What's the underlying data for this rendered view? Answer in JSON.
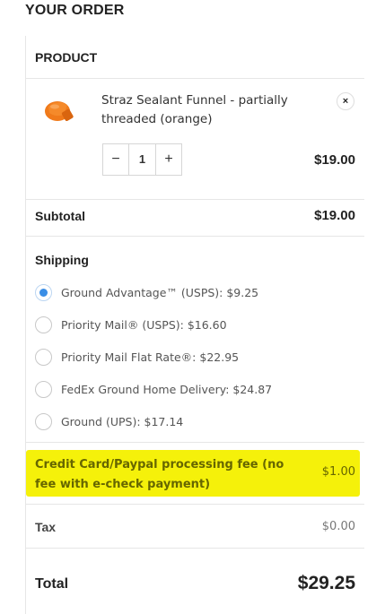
{
  "heading": "YOUR ORDER",
  "table": {
    "column_header": "PRODUCT"
  },
  "product": {
    "name": "Straz Sealant Funnel - partially threaded (orange)",
    "remove_icon": "×",
    "quantity": "1",
    "decrement": "−",
    "increment": "+",
    "price": "$19.00",
    "image_color": "#f07a1a"
  },
  "subtotal": {
    "label": "Subtotal",
    "value": "$19.00"
  },
  "shipping": {
    "label": "Shipping",
    "options": [
      {
        "label": "Ground Advantage™ (USPS): $9.25",
        "selected": true
      },
      {
        "label": "Priority Mail® (USPS): $16.60",
        "selected": false
      },
      {
        "label": "Priority Mail Flat Rate®: $22.95",
        "selected": false
      },
      {
        "label": "FedEx Ground Home Delivery: $24.87",
        "selected": false
      },
      {
        "label": "Ground (UPS): $17.14",
        "selected": false
      }
    ]
  },
  "fee": {
    "label": "Credit Card/Paypal processing fee (no fee with e-check payment)",
    "value": "$1.00",
    "highlight_color": "#f5f10a"
  },
  "tax": {
    "label": "Tax",
    "value": "$0.00"
  },
  "total": {
    "label": "Total",
    "value": "$29.25"
  },
  "colors": {
    "radio_selected": "#3a8ee6",
    "border": "#e6e6e6"
  }
}
